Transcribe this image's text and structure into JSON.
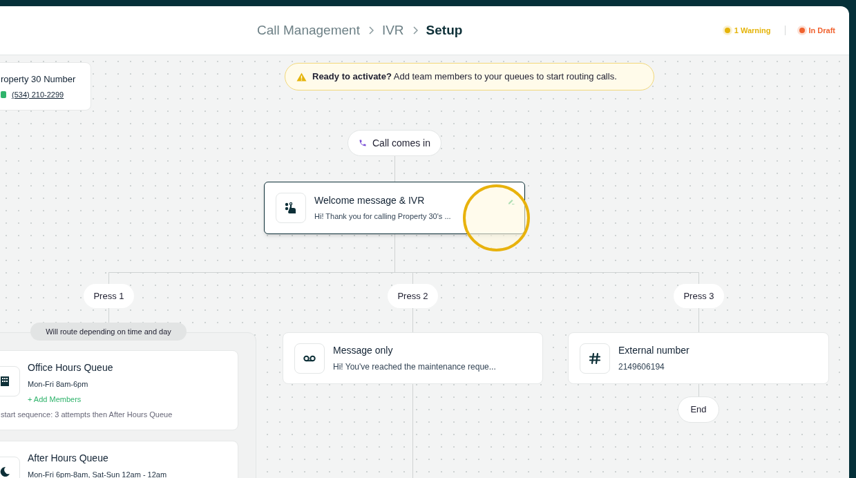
{
  "breadcrumb": [
    {
      "label": "Call Management",
      "current": false
    },
    {
      "label": "IVR",
      "current": false
    },
    {
      "label": "Setup",
      "current": true
    }
  ],
  "status": [
    {
      "label": "1 Warning",
      "color": "#e5b40a"
    },
    {
      "label": "In Draft",
      "color": "#f0622f"
    }
  ],
  "phone_card": {
    "title": "roperty 30 Number",
    "number": "(534) 210-2299"
  },
  "banner": {
    "text": "**Ready to activate?** Add team members to your queues to start routing calls."
  },
  "start": {
    "label": "Call comes in"
  },
  "welcome": {
    "title": "Welcome message & IVR",
    "text": "Hi! Thank you for calling Property 30's ...",
    "selected": true
  },
  "branches": [
    {
      "label": "Press 1",
      "note": "Will route depending on time and day",
      "queues": [
        {
          "kind": "office",
          "title": "Office Hours Queue",
          "hours": "Mon-Fri 8am-6pm",
          "action": "+ Add Members",
          "sequence": "start sequence: 3 attempts then After Hours Queue"
        },
        {
          "kind": "night",
          "title": "After Hours Queue",
          "hours": "Mon-Fri 6pm-8am, Sat-Sun 12am - 12am"
        }
      ]
    },
    {
      "label": "Press 2",
      "node": {
        "kind": "voicemail",
        "title": "Message only",
        "text": "Hi! You've reached the maintenance reque..."
      }
    },
    {
      "label": "Press 3",
      "node": {
        "kind": "hash",
        "title": "External number",
        "text": "2149606194"
      },
      "end": "End"
    }
  ]
}
